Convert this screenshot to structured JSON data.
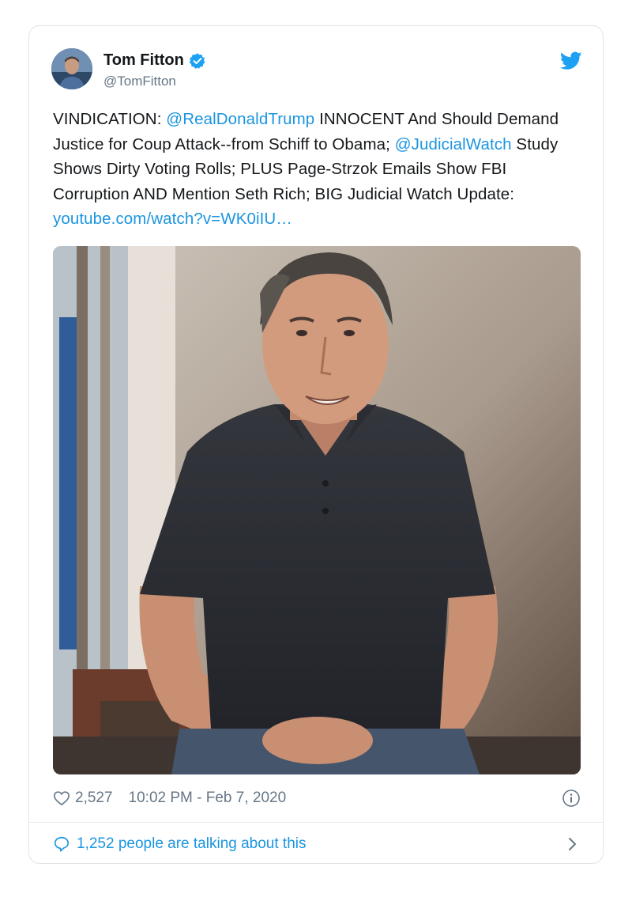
{
  "tweet": {
    "author_name": "Tom Fitton",
    "handle": "@TomFitton",
    "text_parts": {
      "p1": "VINDICATION: ",
      "mention1": "@RealDonaldTrump",
      "p2": " INNOCENT And Should Demand Justice for Coup Attack--from Schiff to Obama; ",
      "mention2": "@JudicialWatch",
      "p3": " Study Shows Dirty Voting Rolls; PLUS Page-Strzok Emails Show FBI Corruption AND Mention Seth Rich; BIG Judicial Watch Update: ",
      "link": "youtube.com/watch?v=WK0iIU…"
    },
    "likes": "2,527",
    "timestamp": "10:02 PM - Feb 7, 2020",
    "talking": "1,252 people are talking about this"
  },
  "icons": {
    "verified": "verified-badge-icon",
    "bird": "twitter-bird-icon",
    "heart": "heart-icon",
    "info": "info-icon",
    "comment": "speech-bubble-icon",
    "chevron": "chevron-right-icon"
  },
  "colors": {
    "link": "#1b95e0",
    "text": "#14171a",
    "muted": "#657786",
    "border": "#dfe3e8"
  }
}
